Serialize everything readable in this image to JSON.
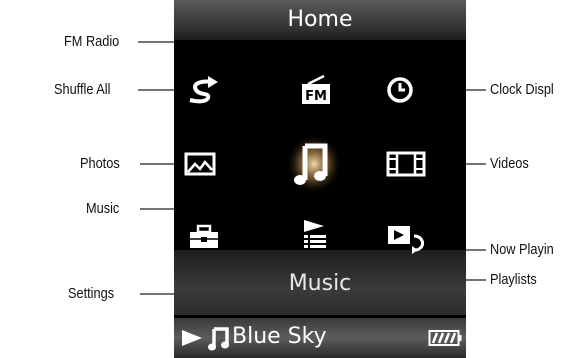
{
  "screen": {
    "header_title": "Home",
    "focused_item_label": "Music",
    "status_track": "Blue Sky",
    "status_icons": [
      "play-icon",
      "music-note-icon",
      "battery-icon"
    ]
  },
  "menu_icons": [
    "fm-radio-icon",
    "shuffle-all-icon",
    "clock-display-icon",
    "photos-icon",
    "music-icon",
    "videos-icon",
    "settings-icon",
    "playlists-icon",
    "now-playing-icon"
  ],
  "callouts": {
    "fm_radio": "FM Radio",
    "shuffle_all": "Shuffle All",
    "clock_display": "Clock Displ",
    "photos": "Photos",
    "music": "Music",
    "videos": "Videos",
    "now_playing": "Now Playin",
    "settings": "Settings",
    "playlists": "Playlists"
  },
  "colors": {
    "screen_bg": "#000000",
    "icon": "#ffffff",
    "music_glow": "#ffd9a0",
    "label_text": "#111111"
  }
}
